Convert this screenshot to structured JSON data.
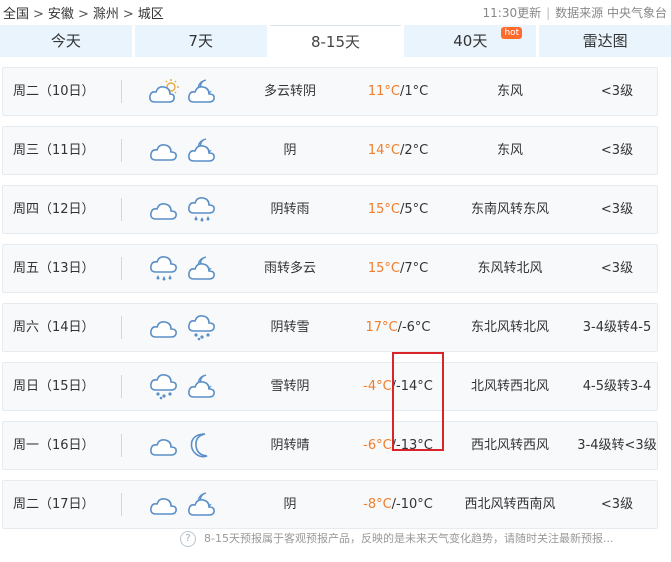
{
  "breadcrumb": [
    "全国",
    "安徽",
    "滁州",
    "城区"
  ],
  "header": {
    "updated": "11:30更新",
    "source": "数据来源 中央气象台"
  },
  "tabs": [
    {
      "label": "今天",
      "active": false
    },
    {
      "label": "7天",
      "active": false
    },
    {
      "label": "8-15天",
      "active": true
    },
    {
      "label": "40天",
      "active": false,
      "badge": "hot"
    },
    {
      "label": "雷达图",
      "active": false
    }
  ],
  "forecast": [
    {
      "date": "周二（10日）",
      "icons": [
        "partly-cloudy-day-icon",
        "cloudy-moon-icon"
      ],
      "desc": "多云转阴",
      "high": "11°C",
      "low": "/1°C",
      "wind": "东风",
      "level": "<3级"
    },
    {
      "date": "周三（11日）",
      "icons": [
        "cloud-icon",
        "cloudy-moon-icon"
      ],
      "desc": "阴",
      "high": "14°C",
      "low": "/2°C",
      "wind": "东风",
      "level": "<3级"
    },
    {
      "date": "周四（12日）",
      "icons": [
        "cloud-icon",
        "rain-icon"
      ],
      "desc": "阴转雨",
      "high": "15°C",
      "low": "/5°C",
      "wind": "东南风转东风",
      "level": "<3级"
    },
    {
      "date": "周五（13日）",
      "icons": [
        "rain-icon",
        "cloudy-moon-icon"
      ],
      "desc": "雨转多云",
      "high": "15°C",
      "low": "/7°C",
      "wind": "东风转北风",
      "level": "<3级"
    },
    {
      "date": "周六（14日）",
      "icons": [
        "cloud-icon",
        "snow-icon"
      ],
      "desc": "阴转雪",
      "high": "17°C",
      "low": "/-6°C",
      "wind": "东北风转北风",
      "level": "3-4级转4-5"
    },
    {
      "date": "周日（15日）",
      "icons": [
        "snow-icon",
        "cloudy-moon-icon"
      ],
      "desc": "雪转阴",
      "high": "-4°C",
      "low": "/-14°C",
      "wind": "北风转西北风",
      "level": "4-5级转3-4"
    },
    {
      "date": "周一（16日）",
      "icons": [
        "cloud-icon",
        "moon-icon"
      ],
      "desc": "阴转晴",
      "high": "-6°C",
      "low": "/-13°C",
      "wind": "西北风转西风",
      "level": "3-4级转<3级"
    },
    {
      "date": "周二（17日）",
      "icons": [
        "cloud-icon",
        "cloudy-moon-icon"
      ],
      "desc": "阴",
      "high": "-8°C",
      "low": "/-10°C",
      "wind": "西北风转西南风",
      "level": "<3级"
    }
  ],
  "footer": {
    "note": "8-15天预报属于客观预报产品，反映的是未来天气变化趋势，请随时关注最新预报..."
  },
  "colors": {
    "tab_bg": "#eaf4fc",
    "high_temp": "#f07d2b",
    "highlight_box": "#d9242c",
    "hot_badge": "#ff6b2c"
  }
}
